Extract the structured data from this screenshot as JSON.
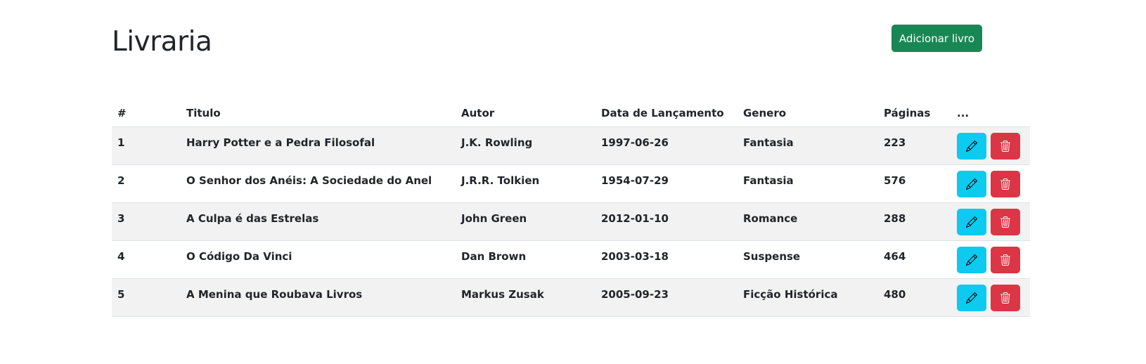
{
  "header": {
    "title": "Livraria",
    "add_button_label": "Adicionar livro"
  },
  "table": {
    "columns": [
      "#",
      "Titulo",
      "Autor",
      "Data de Lançamento",
      "Genero",
      "Páginas",
      "..."
    ],
    "rows": [
      {
        "id": "1",
        "title": "Harry Potter e a Pedra Filosofal",
        "author": "J.K. Rowling",
        "date": "1997-06-26",
        "genre": "Fantasia",
        "pages": "223"
      },
      {
        "id": "2",
        "title": "O Senhor dos Anéis: A Sociedade do Anel",
        "author": "J.R.R. Tolkien",
        "date": "1954-07-29",
        "genre": "Fantasia",
        "pages": "576"
      },
      {
        "id": "3",
        "title": "A Culpa é das Estrelas",
        "author": "John Green",
        "date": "2012-01-10",
        "genre": "Romance",
        "pages": "288"
      },
      {
        "id": "4",
        "title": "O Código Da Vinci",
        "author": "Dan Brown",
        "date": "2003-03-18",
        "genre": "Suspense",
        "pages": "464"
      },
      {
        "id": "5",
        "title": "A Menina que Roubava Livros",
        "author": "Markus Zusak",
        "date": "2005-09-23",
        "genre": "Ficção Histórica",
        "pages": "480"
      }
    ],
    "row_actions": [
      {
        "icon": "pencil-icon",
        "color": "#0dcaf0"
      },
      {
        "icon": "trash-icon",
        "color": "#dc3545"
      }
    ]
  },
  "colors": {
    "add_button": "#198754",
    "stripe": "#f2f2f2"
  }
}
